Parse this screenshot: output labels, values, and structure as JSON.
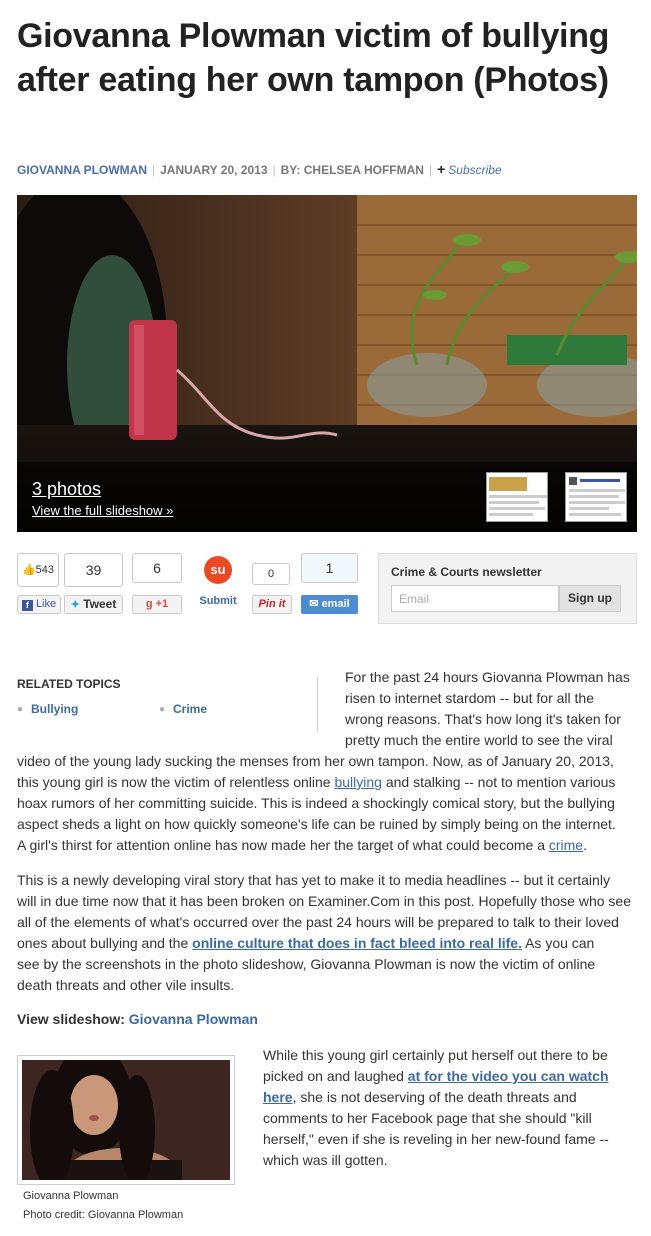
{
  "article": {
    "headline": "Giovanna Plowman victim of bullying after eating her own tampon (Photos)",
    "byline": {
      "tag": "GIOVANNA PLOWMAN",
      "date": "JANUARY 20, 2013",
      "author": "BY: CHELSEA HOFFMAN",
      "subscribe": "Subscribe"
    }
  },
  "slideshow": {
    "count_label": "3 photos",
    "view_label": "View the full slideshow »"
  },
  "social": {
    "fb_count": "543",
    "fb_like": "Like",
    "tweet_count": "39",
    "tweet_label": "Tweet",
    "gplus_count": "6",
    "gplus_label": "+1",
    "stumble_label": "Submit",
    "pin_count": "0",
    "pin_label": "Pin it",
    "email_count": "1",
    "email_label": "email"
  },
  "newsletter": {
    "title": "Crime & Courts newsletter",
    "placeholder": "Email",
    "button": "Sign up"
  },
  "related": {
    "title": "RELATED TOPICS",
    "topics": [
      "Bullying",
      "Crime"
    ]
  },
  "body": {
    "p1_side_lines": [
      "For the past 24 hours Giovanna Plowman has",
      "risen to internet stardom -- but for all the",
      "wrong reasons. That's how long it's taken for",
      "pretty much the entire world to see the viral"
    ],
    "p1_l1": "video of the young lady sucking the menses from her own tampon. Now, as of January 20, 2013,",
    "p1_l2a": "this young girl is now the victim of relentless online ",
    "p1_l2_link": "bullying",
    "p1_l2b": " and stalking -- not to mention various",
    "p1_l3": "hoax rumors of her committing suicide. This is indeed a shockingly comical story, but the bullying",
    "p1_l4": "aspect sheds a light on how quickly someone's life can be ruined by simply being on the internet.",
    "p1_l5a": "A girl's thirst for attention online has now made her the target of what could become a ",
    "p1_l5_link": "crime",
    "p1_l5b": ".",
    "p2_l1": "This is a newly developing viral story that has yet to make it to media headlines -- but it certainly",
    "p2_l2": "will in due time now that it has been broken on Examiner.Com in this post. Hopefully those who see",
    "p2_l3": "all of the elements of what's occurred over the past 24 hours will be prepared to talk to their loved",
    "p2_l4a": "ones about bullying and the ",
    "p2_l4_link": "online culture that does in fact bleed into real life.",
    "p2_l4b": " As you can",
    "p2_l5": "see by the screenshots in the photo slideshow, Giovanna Plowman is now the victim of online",
    "p2_l6": "death threats and other vile insults.",
    "view_slideshow_label": "View slideshow: ",
    "view_slideshow_link": "Giovanna Plowman",
    "p3_l1": "While this young girl certainly put herself out there to be",
    "p3_l2a": "picked on and laughed ",
    "p3_l2_link": "at for the video you can watch",
    "p3_l3_link": "here",
    "p3_l3b": ", she is not deserving of the death threats and",
    "p3_l4": "comments to her Facebook page that she should \"kill",
    "p3_l5": "herself,\" even if she is reveling in her new-found fame --",
    "p3_l6": "which was ill gotten."
  },
  "photo": {
    "caption": "Giovanna Plowman",
    "credit": "Photo credit:  Giovanna Plowman"
  }
}
